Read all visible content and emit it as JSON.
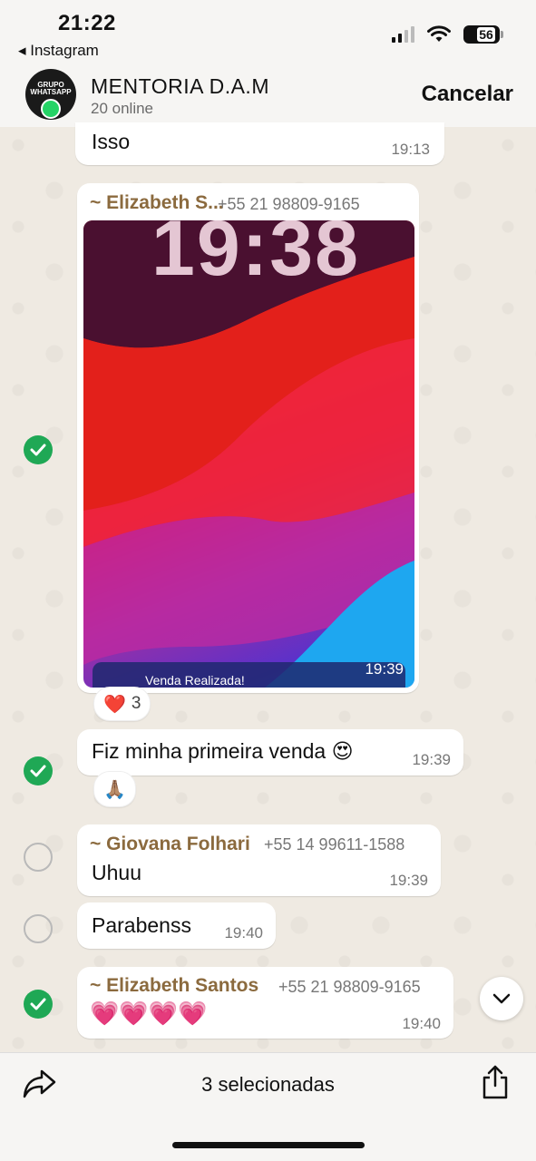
{
  "status_bar": {
    "time": "21:22",
    "back_app": "◂ Instagram",
    "battery": "56"
  },
  "header": {
    "group_name": "MENTORIA D.A.M",
    "online": "20 online",
    "cancel": "Cancelar",
    "avatar_text": "GRUPO WHATSAPP"
  },
  "messages": [
    {
      "text": "Isso",
      "time": "19:13",
      "selected": null
    },
    {
      "sender": "~ Elizabeth S...",
      "phone": "+55 21 98809-9165",
      "image": {
        "clock": "19:38",
        "notification": "Venda Realizada!",
        "time": "19:39"
      },
      "reaction": {
        "emoji": "❤️",
        "count": "3"
      },
      "selected": true
    },
    {
      "text": "Fiz minha primeira venda 😍",
      "time": "19:39",
      "reaction": {
        "emoji": "🙏🏽"
      },
      "selected": true
    },
    {
      "sender": "~ Giovana Folhari",
      "phone": "+55 14 99611-1588",
      "text": "Uhuu",
      "time": "19:39",
      "selected": false
    },
    {
      "text": "Parabenss",
      "time": "19:40",
      "selected": false
    },
    {
      "sender": "~ Elizabeth Santos",
      "phone": "+55 21 98809-9165",
      "text": "💗💗💗💗",
      "time": "19:40",
      "selected": true
    }
  ],
  "bottom_bar": {
    "selected_count": "3 selecionadas"
  },
  "colors": {
    "wallpaper": "#efeae2",
    "check_selected": "#1fa855",
    "sender_name": "#8b6a3e"
  },
  "icons": [
    "forward-icon",
    "share-icon",
    "chevron-down-icon",
    "wifi-icon",
    "signal-icon",
    "battery-icon",
    "check-icon"
  ]
}
